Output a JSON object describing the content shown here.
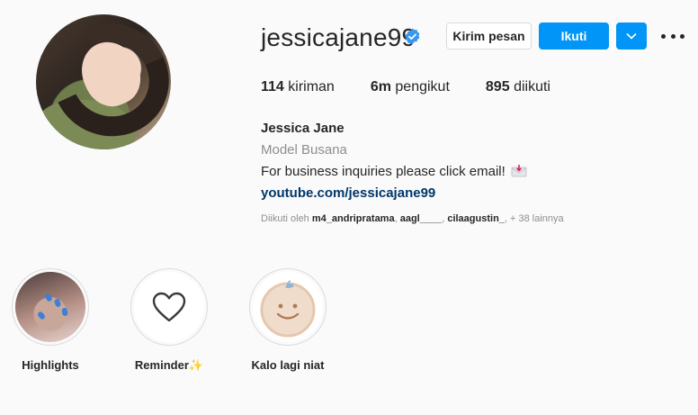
{
  "profile": {
    "username": "jessicajane99",
    "verified": true,
    "buttons": {
      "message": "Kirim pesan",
      "follow": "Ikuti"
    },
    "stats": [
      {
        "value": "114",
        "label": "kiriman"
      },
      {
        "value": "6m",
        "label": "pengikut"
      },
      {
        "value": "895",
        "label": "diikuti"
      }
    ],
    "bio": {
      "name": "Jessica Jane",
      "category": "Model Busana",
      "description": "For business inquiries please click email!",
      "link": "youtube.com/jessicajane99"
    },
    "followed_by": {
      "prefix": "Diikuti oleh",
      "users": [
        "m4_andripratama",
        "aagl____",
        "cilaagustin_"
      ],
      "more": "+ 38 lainnya"
    }
  },
  "highlights": [
    {
      "label": "Highlights",
      "icon": "nails-photo"
    },
    {
      "label": "Reminder✨",
      "icon": "heart-outline-icon"
    },
    {
      "label": "Kalo lagi niat",
      "icon": "smiley-cookie"
    }
  ],
  "colors": {
    "primary": "#0095f6",
    "link": "#00376b",
    "verified": "#3897f0",
    "muted": "#8e8e8e",
    "background": "#fafafa"
  }
}
